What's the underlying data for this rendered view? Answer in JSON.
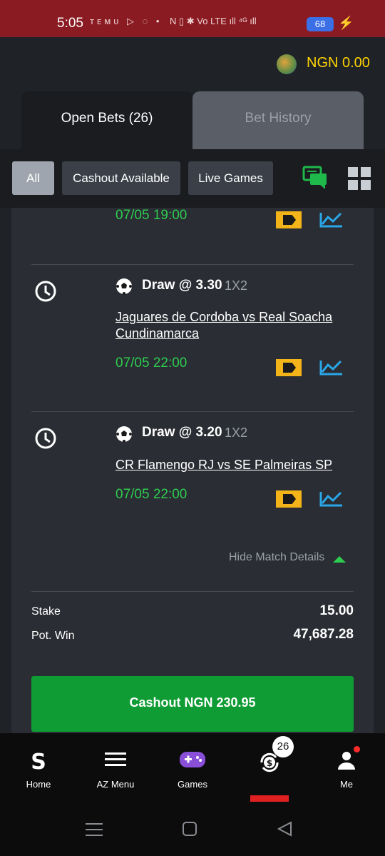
{
  "status_bar": {
    "time": "5:05",
    "left_icons": "ᴛᴇᴍᴜ ▷ ◌ •",
    "right_icons": "N ▯ ✱ Vo LTE ıll ⁴ᴳ ıll",
    "battery": "68",
    "colors": {
      "background": "#8a1b22",
      "battery": "#3b6fe6"
    }
  },
  "header": {
    "balance": "NGN 0.00",
    "balance_color": "#ffd400"
  },
  "tabs": [
    {
      "label": "Open Bets (26)",
      "active": true
    },
    {
      "label": "Bet History",
      "active": false
    }
  ],
  "filters": [
    {
      "label": "All",
      "active": true
    },
    {
      "label": "Cashout Available",
      "active": false
    },
    {
      "label": "Live Games",
      "active": false
    }
  ],
  "bets": [
    {
      "date": "07/05 19:00"
    },
    {
      "pick": "Draw @ 3.30",
      "market": "1X2",
      "teams": "Jaguares de Cordoba vs Real Soacha Cundinamarca",
      "date": "07/05 22:00"
    },
    {
      "pick": "Draw @ 3.20",
      "market": "1X2",
      "teams": "CR Flamengo RJ vs SE Palmeiras SP",
      "date": "07/05 22:00"
    }
  ],
  "details_toggle": "Hide Match Details",
  "summary": {
    "stake_label": "Stake",
    "stake_value": "15.00",
    "potwin_label": "Pot. Win",
    "potwin_value": "47,687.28"
  },
  "cashout_label": "Cashout NGN 230.95",
  "bottom_nav": [
    {
      "label": "Home",
      "icon": "sportybet-logo-icon"
    },
    {
      "label": "AZ Menu",
      "icon": "hamburger-menu-icon"
    },
    {
      "label": "Games",
      "icon": "gamepad-icon"
    },
    {
      "label": "",
      "icon": "cashout-bets-icon",
      "badge": "26",
      "active": true
    },
    {
      "label": "Me",
      "icon": "user-icon"
    }
  ],
  "accent_colors": {
    "green": "#2ecc50",
    "button_green": "#109c34",
    "tv_yellow": "#f2b418",
    "chart_blue": "#2aa7e8"
  }
}
